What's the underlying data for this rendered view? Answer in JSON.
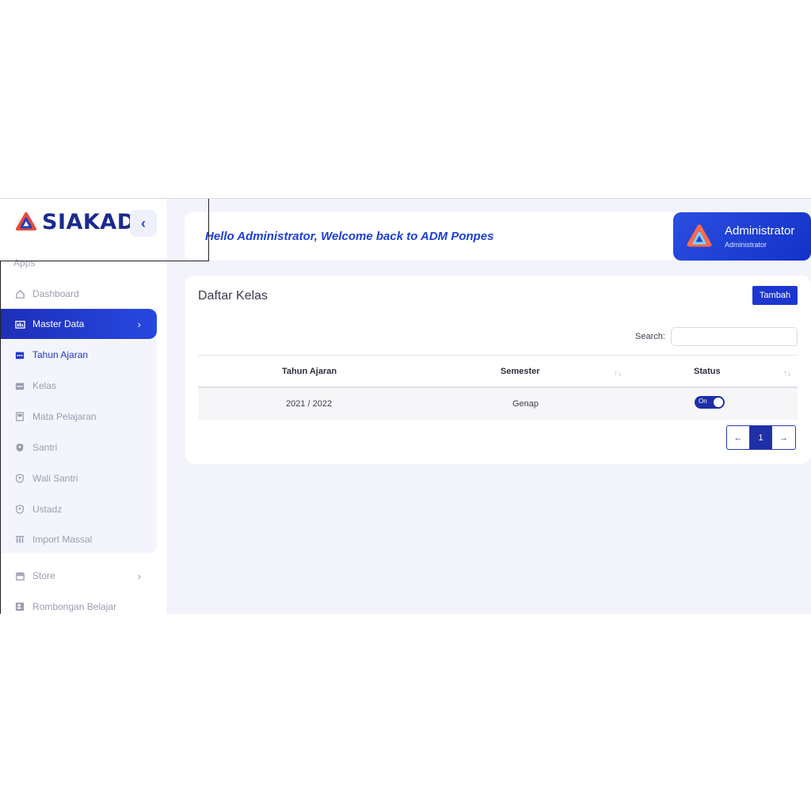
{
  "brand": {
    "name": "SIAKAD"
  },
  "sidebar": {
    "section_label": "Apps",
    "items": [
      {
        "label": "Dashboard",
        "icon": "home-icon"
      },
      {
        "label": "Master Data",
        "icon": "database-icon",
        "state": "active"
      },
      {
        "label": "Tahun Ajaran",
        "icon": "calendar-icon",
        "state": "sub-active"
      },
      {
        "label": "Kelas",
        "icon": "classroom-icon"
      },
      {
        "label": "Mata Pelajaran",
        "icon": "book-icon"
      },
      {
        "label": "Santri",
        "icon": "shield-icon"
      },
      {
        "label": "Wali Santri",
        "icon": "shield-icon"
      },
      {
        "label": "Ustadz",
        "icon": "shield-icon"
      },
      {
        "label": "Import Massal",
        "icon": "table-icon"
      },
      {
        "label": "Store",
        "icon": "store-icon"
      },
      {
        "label": "Rombongan Belajar",
        "icon": "contact-card-icon"
      }
    ]
  },
  "header": {
    "welcome": "Hello Administrator, Welcome back to ADM Ponpes",
    "user_name": "Administrator",
    "user_role": "Administrator"
  },
  "card": {
    "title": "Daftar Kelas",
    "add_label": "Tambah",
    "search_label": "Search:",
    "search_value": ""
  },
  "table": {
    "columns": [
      "Tahun Ajaran",
      "Semester",
      "Status"
    ],
    "sort_glyph": "↑↓",
    "rows": [
      {
        "tahun": "2021 / 2022",
        "semester": "Genap",
        "status": "On"
      }
    ]
  },
  "pagination": {
    "prev": "←",
    "current": "1",
    "next": "→"
  },
  "colors": {
    "primary": "#1d36cf",
    "brand_dark": "#1a2b8f",
    "background": "#f3f4fb"
  }
}
